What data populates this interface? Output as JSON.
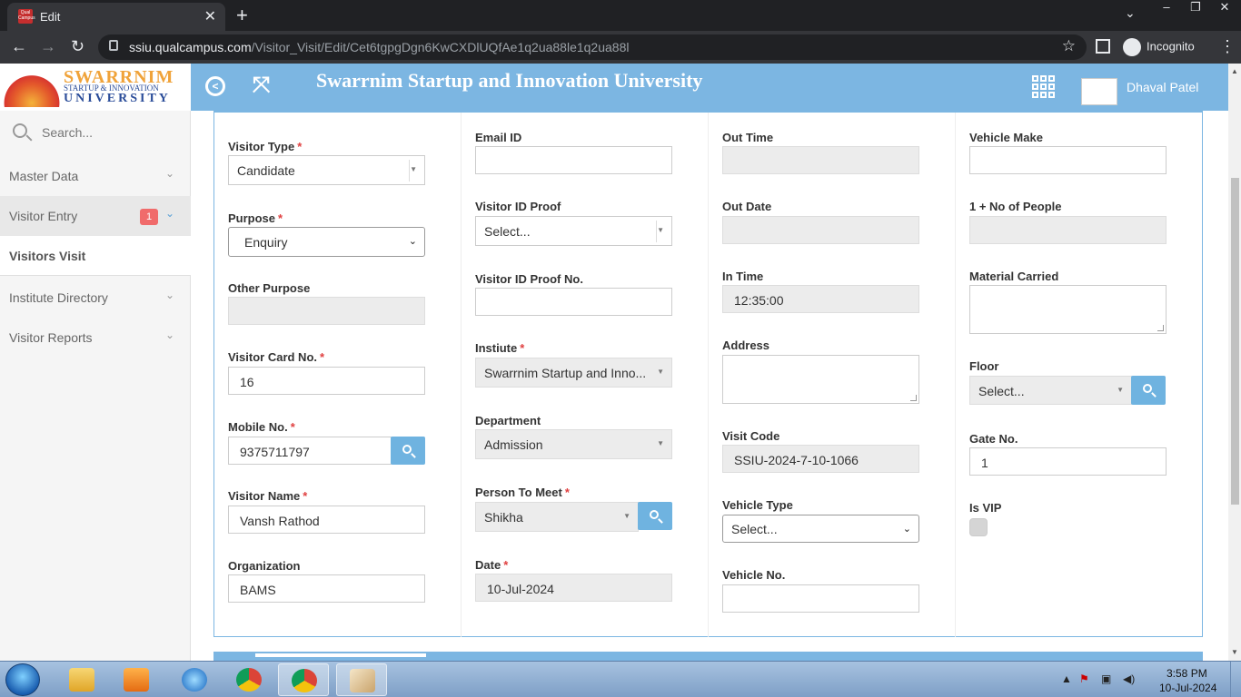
{
  "browser": {
    "tab_title": "Edit",
    "tab_favicon_text": "QualCampus",
    "url_host": "ssiu.qualcampus.com",
    "url_path": "/Visitor_Visit/Edit/Cet6tgpgDgn6KwCXDlUQfAe1q2ua88le1q2ua88l",
    "incognito_label": "Incognito"
  },
  "header": {
    "logo_line1": "SWARRNIM",
    "logo_line2": "STARTUP & INNOVATION",
    "logo_line3": "UNIVERSITY",
    "title": "Swarrnim Startup and Innovation University",
    "user_name": "Dhaval Patel"
  },
  "sidebar": {
    "search_placeholder": "Search...",
    "items": [
      {
        "label": "Master Data"
      },
      {
        "label": "Visitor Entry",
        "badge": "1"
      },
      {
        "label": "Visitors Visit"
      },
      {
        "label": "Institute Directory"
      },
      {
        "label": "Visitor Reports"
      }
    ]
  },
  "form": {
    "visitor_type": {
      "label": "Visitor Type",
      "value": "Candidate"
    },
    "purpose": {
      "label": "Purpose",
      "value": "Enquiry"
    },
    "other_purpose": {
      "label": "Other Purpose",
      "value": ""
    },
    "visitor_card_no": {
      "label": "Visitor Card No.",
      "value": "16"
    },
    "mobile_no": {
      "label": "Mobile No.",
      "value": "9375711797"
    },
    "visitor_name": {
      "label": "Visitor Name",
      "value": "Vansh Rathod"
    },
    "organization": {
      "label": "Organization",
      "value": "BAMS"
    },
    "email_id": {
      "label": "Email ID",
      "value": ""
    },
    "visitor_id_proof": {
      "label": "Visitor ID Proof",
      "value": "Select..."
    },
    "visitor_id_proof_no": {
      "label": "Visitor ID Proof No.",
      "value": ""
    },
    "institute": {
      "label": "Instiute",
      "value": "Swarrnim Startup and Inno..."
    },
    "department": {
      "label": "Department",
      "value": "Admission"
    },
    "person_to_meet": {
      "label": "Person To Meet",
      "value": "Shikha"
    },
    "date": {
      "label": "Date",
      "value": "10-Jul-2024"
    },
    "out_time": {
      "label": "Out Time",
      "value": ""
    },
    "out_date": {
      "label": "Out Date",
      "value": ""
    },
    "in_time": {
      "label": "In Time",
      "value": "12:35:00"
    },
    "address": {
      "label": "Address",
      "value": ""
    },
    "visit_code": {
      "label": "Visit Code",
      "value": "SSIU-2024-7-10-1066"
    },
    "vehicle_type": {
      "label": "Vehicle Type",
      "value": "Select..."
    },
    "vehicle_no": {
      "label": "Vehicle No.",
      "value": ""
    },
    "vehicle_make": {
      "label": "Vehicle Make",
      "value": ""
    },
    "no_of_people": {
      "label": "1 + No of People",
      "value": ""
    },
    "material_carried": {
      "label": "Material Carried",
      "value": ""
    },
    "floor": {
      "label": "Floor",
      "value": "Select..."
    },
    "gate_no": {
      "label": "Gate No.",
      "value": "1"
    },
    "is_vip": {
      "label": "Is VIP",
      "checked": false
    }
  },
  "taskbar": {
    "time": "3:58 PM",
    "date": "10-Jul-2024"
  },
  "colors": {
    "header_blue": "#7cb6e2",
    "button_blue": "#6fb3e0",
    "required_red": "#e04040",
    "badge_red": "#f06b6b"
  }
}
